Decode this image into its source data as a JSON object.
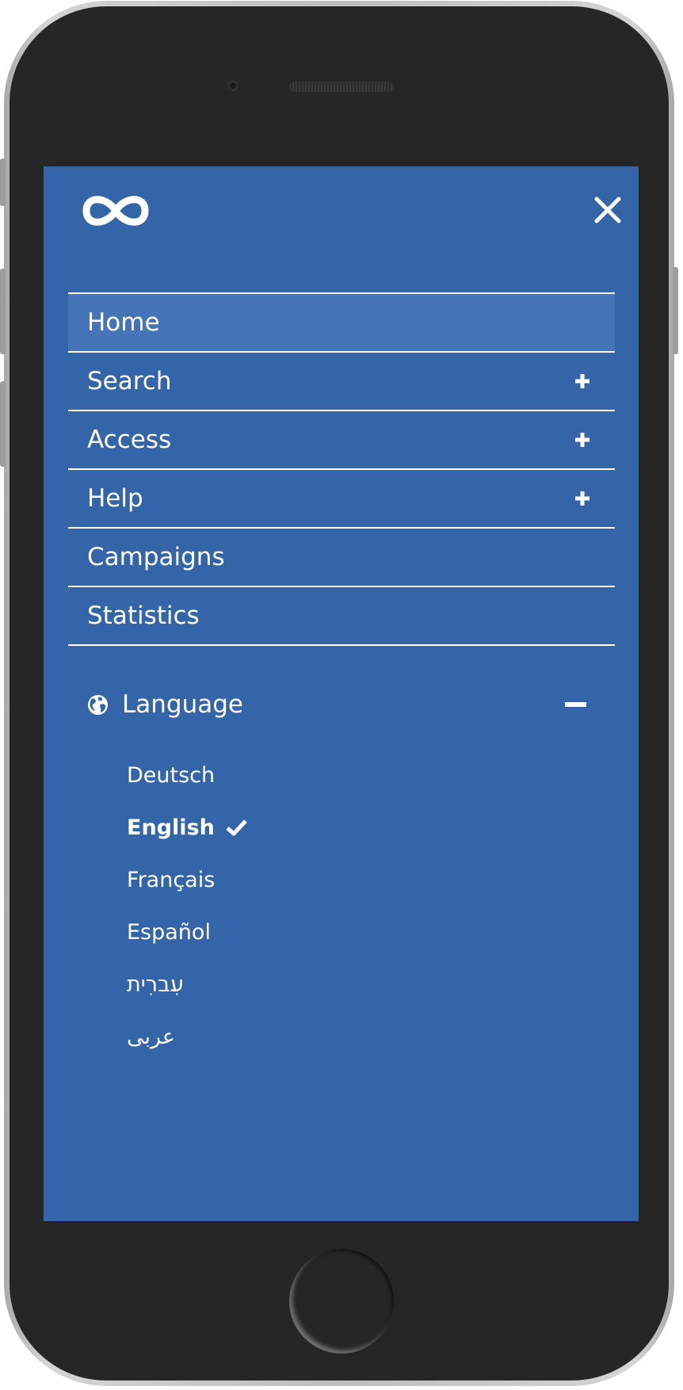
{
  "header": {
    "logo_icon": "infinity-logo-icon",
    "close_icon": "close-icon"
  },
  "menu": {
    "items": [
      {
        "label": "Home",
        "expandable": false,
        "active": true
      },
      {
        "label": "Search",
        "expandable": true,
        "active": false
      },
      {
        "label": "Access",
        "expandable": true,
        "active": false
      },
      {
        "label": "Help",
        "expandable": true,
        "active": false
      },
      {
        "label": "Campaigns",
        "expandable": false,
        "active": false
      },
      {
        "label": "Statistics",
        "expandable": false,
        "active": false
      }
    ]
  },
  "language": {
    "label": "Language",
    "icon": "globe-icon",
    "expanded": true,
    "options": [
      {
        "label": "Deutsch",
        "selected": false
      },
      {
        "label": "English",
        "selected": true
      },
      {
        "label": "Français",
        "selected": false
      },
      {
        "label": "Español",
        "selected": false
      },
      {
        "label": "עִברִית",
        "selected": false
      },
      {
        "label": "عربى",
        "selected": false
      }
    ]
  },
  "colors": {
    "screen_background": "#3465a9",
    "active_item_background": "#4574b8",
    "text": "#ffffff",
    "device_body": "#262626"
  }
}
